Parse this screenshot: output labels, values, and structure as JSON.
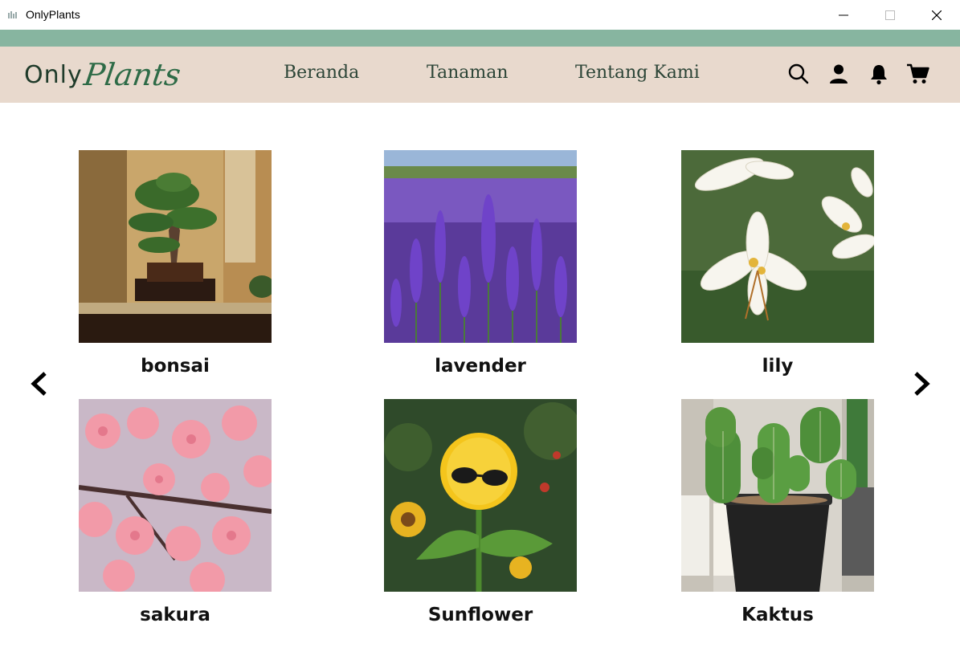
{
  "window": {
    "title": "OnlyPlants",
    "minimize_glyph": "—",
    "maximize_glyph": "☐",
    "close_glyph": "✕"
  },
  "colors": {
    "accent_strip": "#87b5a0",
    "navbar_bg": "#e8d9cd",
    "nav_text": "#2b4436",
    "logo_dark": "#1f3b2a",
    "logo_green": "#2e6b47"
  },
  "brand": {
    "part1": "Only",
    "part2": "Plants"
  },
  "nav": {
    "links": [
      "Beranda",
      "Tanaman",
      "Tentang Kami"
    ],
    "icons": [
      "search-icon",
      "user-icon",
      "bell-icon",
      "cart-icon"
    ]
  },
  "carousel": {
    "prev_icon": "chevron-left-icon",
    "next_icon": "chevron-right-icon"
  },
  "plants": [
    {
      "name": "bonsai"
    },
    {
      "name": "lavender"
    },
    {
      "name": "lily"
    },
    {
      "name": "sakura"
    },
    {
      "name": "Sunflower"
    },
    {
      "name": "Kaktus"
    }
  ]
}
